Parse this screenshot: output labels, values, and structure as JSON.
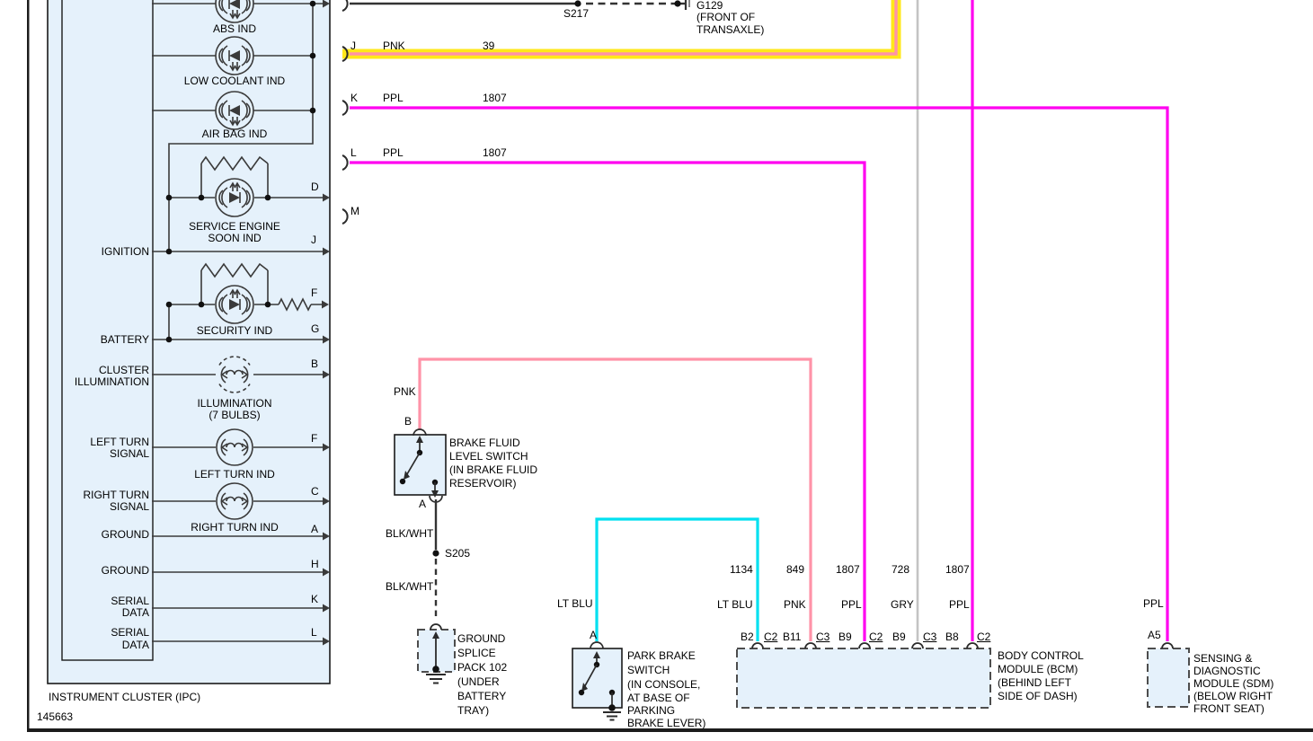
{
  "doc_number": "145663",
  "palette": {
    "highlight_yellow": "#ffe81a",
    "pnk": "#ff93a8",
    "ppl": "#ff00f0",
    "lt_blu": "#00e0f0",
    "gry": "#c3c3c3",
    "blk": "#333333",
    "box_fill": "#e5f1fb"
  },
  "ipc": {
    "label": "INSTRUMENT CLUSTER (IPC)",
    "left_pins": [
      "IGNITION",
      "BATTERY",
      "CLUSTER",
      "ILLUMINATION",
      "LEFT TURN",
      "SIGNAL",
      "RIGHT TURN",
      "SIGNAL",
      "GROUND",
      "GROUND",
      "SERIAL",
      "DATA",
      "SERIAL",
      "DATA"
    ],
    "indicators": [
      "ABS IND",
      "LOW COOLANT IND",
      "AIR BAG IND",
      "SERVICE ENGINE",
      "SOON IND",
      "SECURITY IND",
      "ILLUMINATION",
      "(7 BULBS)",
      "LEFT TURN IND",
      "RIGHT TURN IND"
    ],
    "conn_letters": [
      "D",
      "J",
      "F",
      "G",
      "B",
      "F",
      "C",
      "A",
      "H",
      "K",
      "L"
    ]
  },
  "top_circuit": {
    "splice": "S217",
    "ground_id": "G129",
    "ground_loc1": "(FRONT OF",
    "ground_loc2": "TRANSAXLE)"
  },
  "ipc_wires": [
    {
      "letter": "J",
      "color": "PNK",
      "circuit": "39"
    },
    {
      "letter": "K",
      "color": "PPL",
      "circuit": "1807"
    },
    {
      "letter": "L",
      "color": "PPL",
      "circuit": "1807"
    },
    {
      "letter": "M",
      "color": "",
      "circuit": ""
    }
  ],
  "brake_fluid_switch": {
    "wire_color": "PNK",
    "pin_top": "B",
    "pin_bottom": "A",
    "name": [
      "BRAKE FLUID",
      "LEVEL SWITCH",
      "(IN BRAKE FLUID",
      "RESERVOIR)"
    ],
    "wire_below_color": "BLK/WHT",
    "splice": "S205",
    "wire_below2_color": "BLK/WHT"
  },
  "ground_splice_pack": {
    "name": [
      "GROUND",
      "SPLICE",
      "PACK 102",
      "(UNDER",
      "BATTERY",
      "TRAY)"
    ]
  },
  "park_brake_switch": {
    "pin": "A",
    "wire_color": "LT BLU",
    "name": [
      "PARK BRAKE",
      "SWITCH",
      "(IN CONSOLE,",
      "AT BASE OF",
      "PARKING",
      "BRAKE LEVER)"
    ]
  },
  "bcm": {
    "circuits": [
      "1134",
      "849",
      "1807",
      "728",
      "1807"
    ],
    "wire_colors": [
      "LT BLU",
      "PNK",
      "PPL",
      "GRY",
      "PPL"
    ],
    "pins": [
      "B2",
      "C2",
      "B11",
      "C3",
      "B9",
      "C2",
      "B9",
      "C3",
      "B8",
      "C2"
    ],
    "name": [
      "BODY CONTROL",
      "MODULE (BCM)",
      "(BEHIND LEFT",
      "SIDE OF DASH)"
    ]
  },
  "sdm": {
    "pin": "A5",
    "wire_color": "PPL",
    "name": [
      "SENSING &",
      "DIAGNOSTIC",
      "MODULE (SDM)",
      "(BELOW RIGHT",
      "FRONT SEAT)"
    ]
  }
}
